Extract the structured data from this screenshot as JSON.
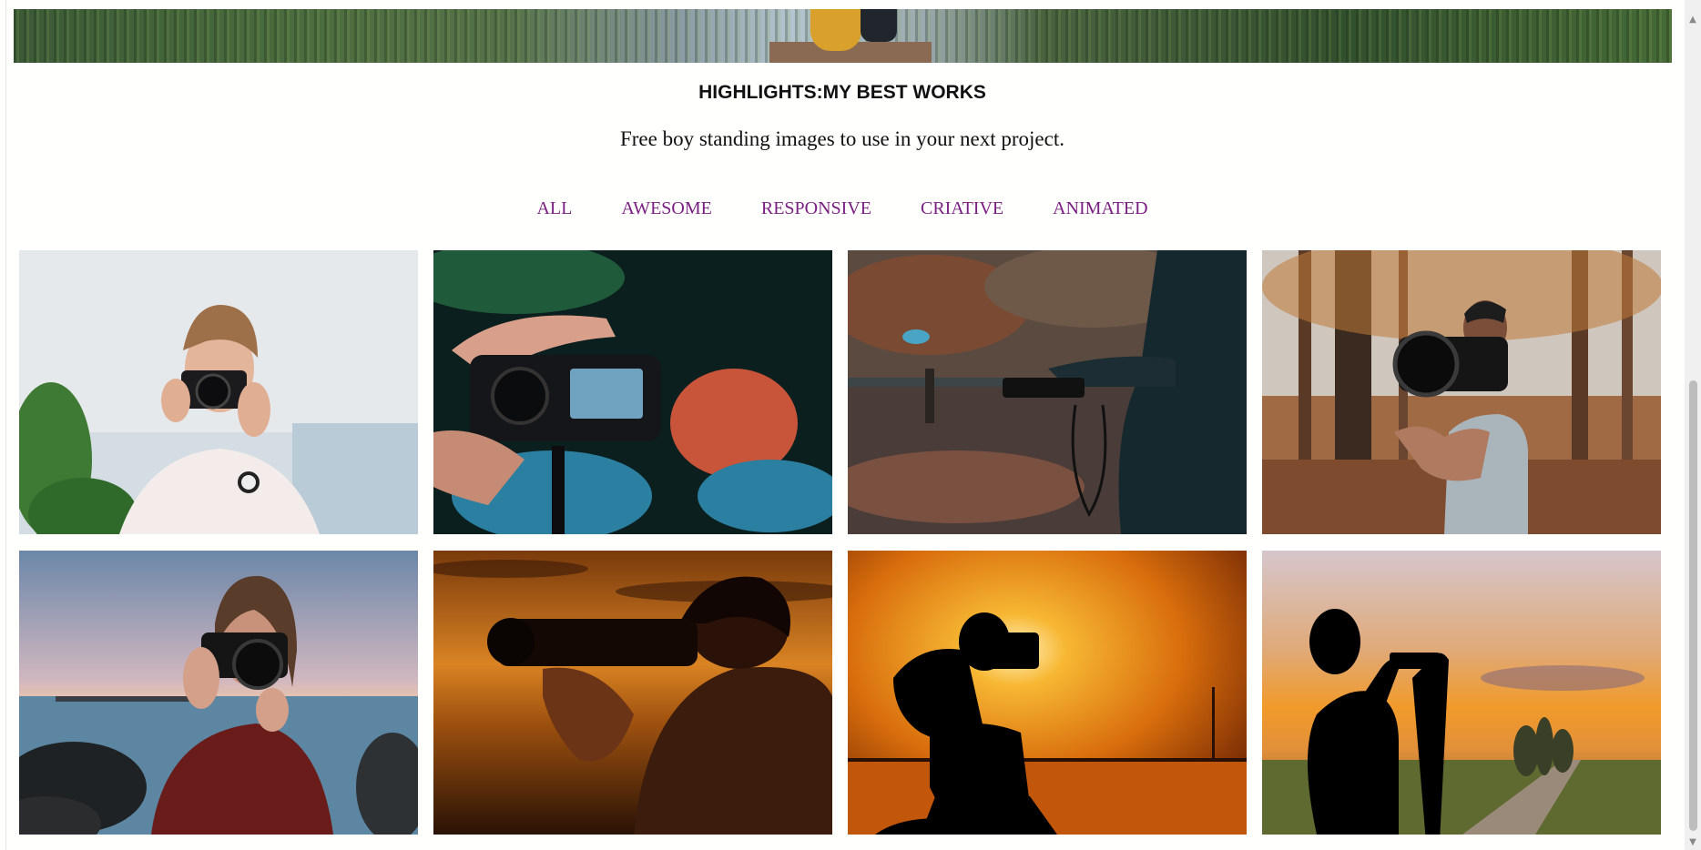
{
  "section": {
    "title": "HIGHLIGHTS:MY BEST WORKS",
    "subtitle": "Free boy standing images to use in your next project."
  },
  "filters": [
    "ALL",
    "AWESOME",
    "RESPONSIVE",
    "CRIATIVE",
    "ANIMATED"
  ],
  "colors": {
    "filter_link": "#7a1f82",
    "page_background": "#fffffd"
  },
  "scrollbar": {
    "up_icon": "▲",
    "down_icon": "▼"
  }
}
